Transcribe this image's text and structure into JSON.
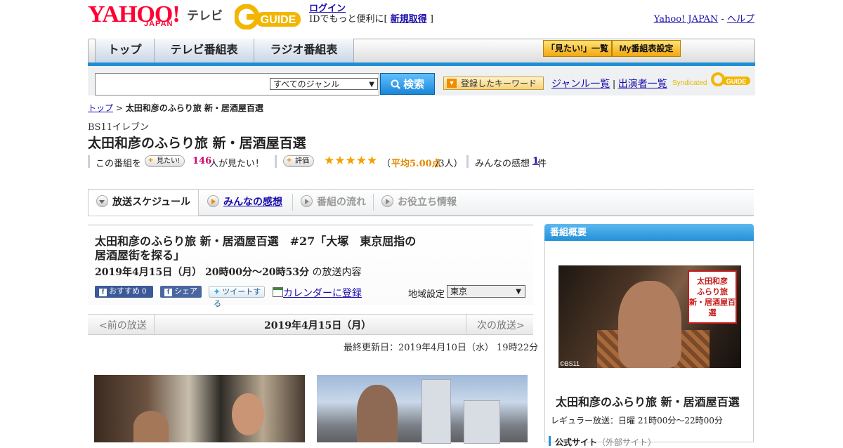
{
  "header": {
    "logo_yahoo": "YAHOO!",
    "logo_japan": "JAPAN",
    "logo_tv": "テレビ",
    "gguide_logo": "GUIDE",
    "login_link": "ログイン",
    "login_note_prefix": "IDでもっと便利に[ ",
    "signup_link": "新規取得",
    "login_note_suffix": " ]",
    "yahoo_japan_link": "Yahoo! JAPAN",
    "help_link": "ヘルプ"
  },
  "nav": {
    "tabs": [
      "トップ",
      "テレビ番組表",
      "ラジオ番組表"
    ],
    "want_list_btn": "「見たい!」一覧",
    "my_schedule_btn": "My番組表設定"
  },
  "search": {
    "genre_selected": "すべてのジャンル",
    "search_btn": "検索",
    "keyword_btn": "登録したキーワード",
    "genre_list_link": "ジャンル一覧",
    "performer_list_link": "出演者一覧",
    "syndicated": "Syndicated",
    "syndicated_logo": "GUIDE"
  },
  "breadcrumb": {
    "top": "トップ",
    "sep": " > ",
    "current": "太田和彦のふらり旅 新・居酒屋百選"
  },
  "program": {
    "channel": "BS11イレブン",
    "title": "太田和彦のふらり旅 新・居酒屋百選",
    "want_prefix": "この番組を",
    "want_pill": "見たい!",
    "want_count": "146",
    "want_suffix": "人が見たい！",
    "rating_pill": "評価",
    "stars": "★★★★★",
    "stars_value": 5,
    "rating_open": "（",
    "rating_avg": "平均5.00点",
    "rating_users": "/3人）",
    "comments_label": "みんなの感想 ",
    "comments_count": "1",
    "comments_suffix": "件"
  },
  "tabs": [
    {
      "label": "放送スケジュール"
    },
    {
      "label": "みんなの感想"
    },
    {
      "label": "番組の流れ"
    },
    {
      "label": "お役立ち情報"
    }
  ],
  "episode": {
    "title": "太田和彦のふらり旅 新・居酒屋百選　#27「大塚　東京屈指の居酒屋街を探る」",
    "date": "2019年4月15日（月）  20時00分～20時53分",
    "date_suffix": " の放送内容",
    "fb_recommend": "おすすめ 0",
    "fb_share": "シェア",
    "tweet": "ツイートする",
    "calendar_link": "カレンダーに登録",
    "region_label": "地域設定",
    "region_value": "東京"
  },
  "pager": {
    "prev": "<前の放送",
    "current": "2019年4月15日（月）",
    "next": "次の放送>"
  },
  "updated": "最終更新日：2019年4月10日（水）  19時22分",
  "sidebar": {
    "header": "番組概要",
    "seal_text": "太田和彦のふらり旅 新・居酒屋百選",
    "copyright": "©BS11",
    "title": "太田和彦のふらり旅 新・居酒屋百選",
    "regular": "レギュラー放送：日曜 21時00分～22時00分",
    "official": "公式サイト",
    "official_note": "（外部サイト）"
  },
  "colors": {
    "accent_blue": "#1e8fd6",
    "yahoo_red": "#ff0033",
    "link": "#1a0dab",
    "star": "#f5a000"
  }
}
